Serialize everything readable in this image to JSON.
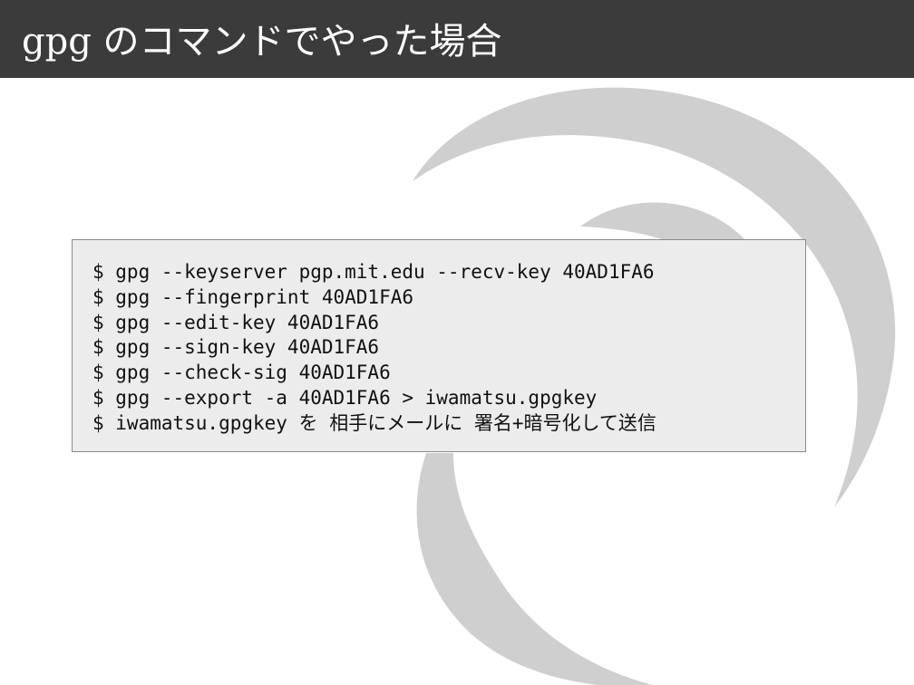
{
  "slide": {
    "title": "gpg のコマンドでやった場合"
  },
  "commands": [
    "$ gpg --keyserver pgp.mit.edu --recv-key 40AD1FA6",
    "$ gpg --fingerprint 40AD1FA6",
    "$ gpg --edit-key 40AD1FA6",
    "$ gpg --sign-key 40AD1FA6",
    "$ gpg --check-sig 40AD1FA6",
    "$ gpg --export -a 40AD1FA6 > iwamatsu.gpgkey",
    "$ iwamatsu.gpgkey を 相手にメールに 署名+暗号化して送信"
  ],
  "colors": {
    "title_bar": "#3b3b3b",
    "code_background": "#ececec",
    "swirl": "#cfcfcf"
  },
  "icons": {
    "background_logo": "debian-swirl-logo"
  }
}
